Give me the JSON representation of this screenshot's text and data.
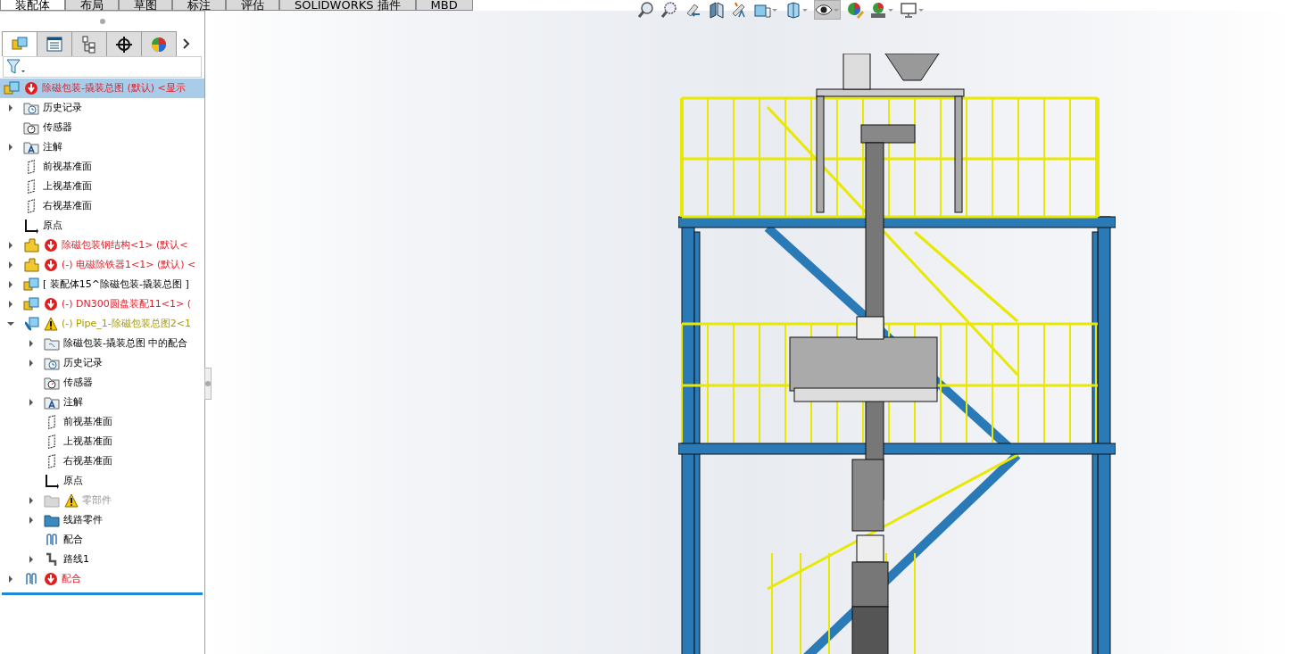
{
  "command_tabs": [
    {
      "label": "装配体",
      "selected": true
    },
    {
      "label": "布局",
      "selected": false
    },
    {
      "label": "草图",
      "selected": false
    },
    {
      "label": "标注",
      "selected": false
    },
    {
      "label": "评估",
      "selected": false
    },
    {
      "label": "SOLIDWORKS 插件",
      "selected": false
    },
    {
      "label": "MBD",
      "selected": false
    }
  ],
  "manager_tabs": [
    {
      "kind": "feature",
      "selected": true
    },
    {
      "kind": "property",
      "selected": false
    },
    {
      "kind": "config",
      "selected": false
    },
    {
      "kind": "dimxpert",
      "selected": false
    },
    {
      "kind": "display",
      "selected": false
    }
  ],
  "tree": {
    "label": "除磁包装-撬装总图 (默认) <显示",
    "kind": "assembly",
    "error": true,
    "warning": false,
    "suppressed": false,
    "selected": true,
    "children": [
      {
        "label": "历史记录",
        "kind": "history",
        "error": false,
        "warning": false,
        "suppressed": false,
        "expandable": true,
        "expanded": false,
        "selected": false
      },
      {
        "label": "传感器",
        "kind": "sensor",
        "error": false,
        "warning": false,
        "suppressed": false,
        "expandable": false,
        "selected": false
      },
      {
        "label": "注解",
        "kind": "annotation",
        "error": false,
        "warning": false,
        "suppressed": false,
        "expandable": true,
        "expanded": false,
        "selected": false
      },
      {
        "label": "前视基准面",
        "kind": "plane",
        "error": false,
        "warning": false,
        "suppressed": false,
        "expandable": false,
        "selected": false
      },
      {
        "label": "上视基准面",
        "kind": "plane",
        "error": false,
        "warning": false,
        "suppressed": false,
        "expandable": false,
        "selected": false
      },
      {
        "label": "右视基准面",
        "kind": "plane",
        "error": false,
        "warning": false,
        "suppressed": false,
        "expandable": false,
        "selected": false
      },
      {
        "label": "原点",
        "kind": "origin",
        "error": false,
        "warning": false,
        "suppressed": false,
        "expandable": false,
        "selected": false
      },
      {
        "label": "除磁包装钢结构<1> (默认<",
        "kind": "part-assembly",
        "error": true,
        "warning": false,
        "suppressed": false,
        "expandable": true,
        "expanded": false,
        "selected": false
      },
      {
        "label": "(-) 电磁除铁器1<1> (默认) <",
        "kind": "part-assembly",
        "error": true,
        "warning": false,
        "suppressed": false,
        "expandable": true,
        "expanded": false,
        "selected": false
      },
      {
        "label": "[ 装配体15^除磁包装-撬装总图 ]",
        "kind": "assembly",
        "error": false,
        "warning": false,
        "suppressed": false,
        "expandable": true,
        "expanded": false,
        "selected": false
      },
      {
        "label": "(-) DN300圆盘装配11<1> (",
        "kind": "assembly",
        "error": true,
        "warning": false,
        "suppressed": false,
        "expandable": true,
        "expanded": false,
        "selected": false
      },
      {
        "label": "(-) Pipe_1-除磁包装总图2<1",
        "kind": "pipe-assembly",
        "error": false,
        "warning": true,
        "suppressed": false,
        "expandable": true,
        "expanded": true,
        "selected": false,
        "children": [
          {
            "label": "除磁包装-撬装总图 中的配合",
            "kind": "mate-folder",
            "error": false,
            "warning": false,
            "suppressed": false,
            "expandable": true,
            "expanded": false,
            "selected": false
          },
          {
            "label": "历史记录",
            "kind": "history",
            "error": false,
            "warning": false,
            "suppressed": false,
            "expandable": true,
            "expanded": false,
            "selected": false
          },
          {
            "label": "传感器",
            "kind": "sensor",
            "error": false,
            "warning": false,
            "suppressed": false,
            "expandable": false,
            "selected": false
          },
          {
            "label": "注解",
            "kind": "annotation",
            "error": false,
            "warning": false,
            "suppressed": false,
            "expandable": true,
            "expanded": false,
            "selected": false
          },
          {
            "label": "前视基准面",
            "kind": "plane",
            "error": false,
            "warning": false,
            "suppressed": false,
            "expandable": false,
            "selected": false
          },
          {
            "label": "上视基准面",
            "kind": "plane",
            "error": false,
            "warning": false,
            "suppressed": false,
            "expandable": false,
            "selected": false
          },
          {
            "label": "右视基准面",
            "kind": "plane",
            "error": false,
            "warning": false,
            "suppressed": false,
            "expandable": false,
            "selected": false
          },
          {
            "label": "原点",
            "kind": "origin",
            "error": false,
            "warning": false,
            "suppressed": false,
            "expandable": false,
            "selected": false
          },
          {
            "label": "零部件",
            "kind": "folder",
            "error": false,
            "warning": true,
            "suppressed": true,
            "expandable": true,
            "expanded": false,
            "selected": false
          },
          {
            "label": "线路零件",
            "kind": "folder",
            "error": false,
            "warning": false,
            "suppressed": false,
            "expandable": true,
            "expanded": false,
            "selected": false
          },
          {
            "label": "配合",
            "kind": "mates",
            "error": false,
            "warning": false,
            "suppressed": false,
            "expandable": false,
            "selected": false
          },
          {
            "label": "路线1",
            "kind": "route",
            "error": false,
            "warning": false,
            "suppressed": false,
            "expandable": true,
            "expanded": false,
            "selected": false
          }
        ]
      },
      {
        "label": "配合",
        "kind": "mates",
        "error": true,
        "warning": false,
        "suppressed": false,
        "expandable": true,
        "expanded": false,
        "selected": false
      }
    ]
  },
  "view_toolbar": [
    {
      "kind": "zoom-fit"
    },
    {
      "kind": "zoom-area"
    },
    {
      "kind": "previous"
    },
    {
      "kind": "section"
    },
    {
      "kind": "annotation"
    },
    {
      "kind": "orientation"
    },
    {
      "kind": "display-style"
    },
    {
      "kind": "hide-show"
    },
    {
      "kind": "appearance"
    },
    {
      "kind": "scene"
    },
    {
      "kind": "monitor"
    }
  ]
}
